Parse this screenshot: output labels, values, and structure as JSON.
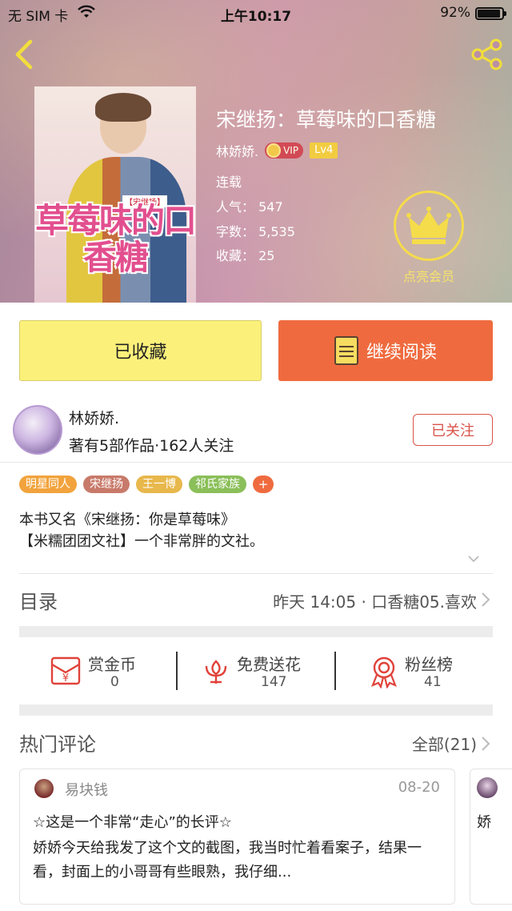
{
  "status_bar": {
    "carrier": "无 SIM 卡",
    "time": "上午10:17",
    "battery": "92%"
  },
  "book": {
    "title": "宋继扬：草莓味的口香糖",
    "author": "林娇娇.",
    "vip_label": "VIP",
    "level": "Lv4",
    "status": "连载",
    "popularity": "人气：  547",
    "word_count": "字数：  5,535",
    "favorites": "收藏：  25",
    "cover_title": "草莓味的口香糖",
    "cover_tag": "【宋继扬】"
  },
  "vip_light": {
    "label": "点亮会员"
  },
  "actions": {
    "collected": "已收藏",
    "continue_reading": "继续阅读"
  },
  "author_card": {
    "name": "林娇娇.",
    "summary": "著有5部作品·162人关注",
    "follow_label": "已关注"
  },
  "tags": [
    {
      "label": "明星同人",
      "color": "#f2a33d"
    },
    {
      "label": "宋继扬",
      "color": "#c87a6a"
    },
    {
      "label": "王一博",
      "color": "#e8b84c"
    },
    {
      "label": "祁氏家族",
      "color": "#8bbf5a"
    }
  ],
  "tag_more": "+",
  "description": {
    "line1": "本书又名《宋继扬：你是草莓味》",
    "line2": "【米糯团团文社】一个非常胖的文社。"
  },
  "catalog": {
    "title": "目录",
    "latest": "昨天 14:05 · 口香糖05.喜欢"
  },
  "stats": [
    {
      "label": "赏金币",
      "value": "0"
    },
    {
      "label": "免费送花",
      "value": "147"
    },
    {
      "label": "粉丝榜",
      "value": "41"
    }
  ],
  "hot_comments": {
    "title": "热门评论",
    "all_label": "全部(21)",
    "items": [
      {
        "user": "易块钱",
        "date": "08-20",
        "title": "☆这是一个非常“走心”的长评☆",
        "body": "娇娇今天给我发了这个文的截图，我当时忙着看案子，结果一看，封面上的小哥哥有些眼熟，我仔细..."
      }
    ],
    "peek_text": "娇"
  },
  "colors": {
    "accent_orange": "#ef6b3f",
    "collect_yellow": "#fbf17a",
    "follow_red": "#d9544a",
    "vip_gold": "#f5dc4a"
  }
}
